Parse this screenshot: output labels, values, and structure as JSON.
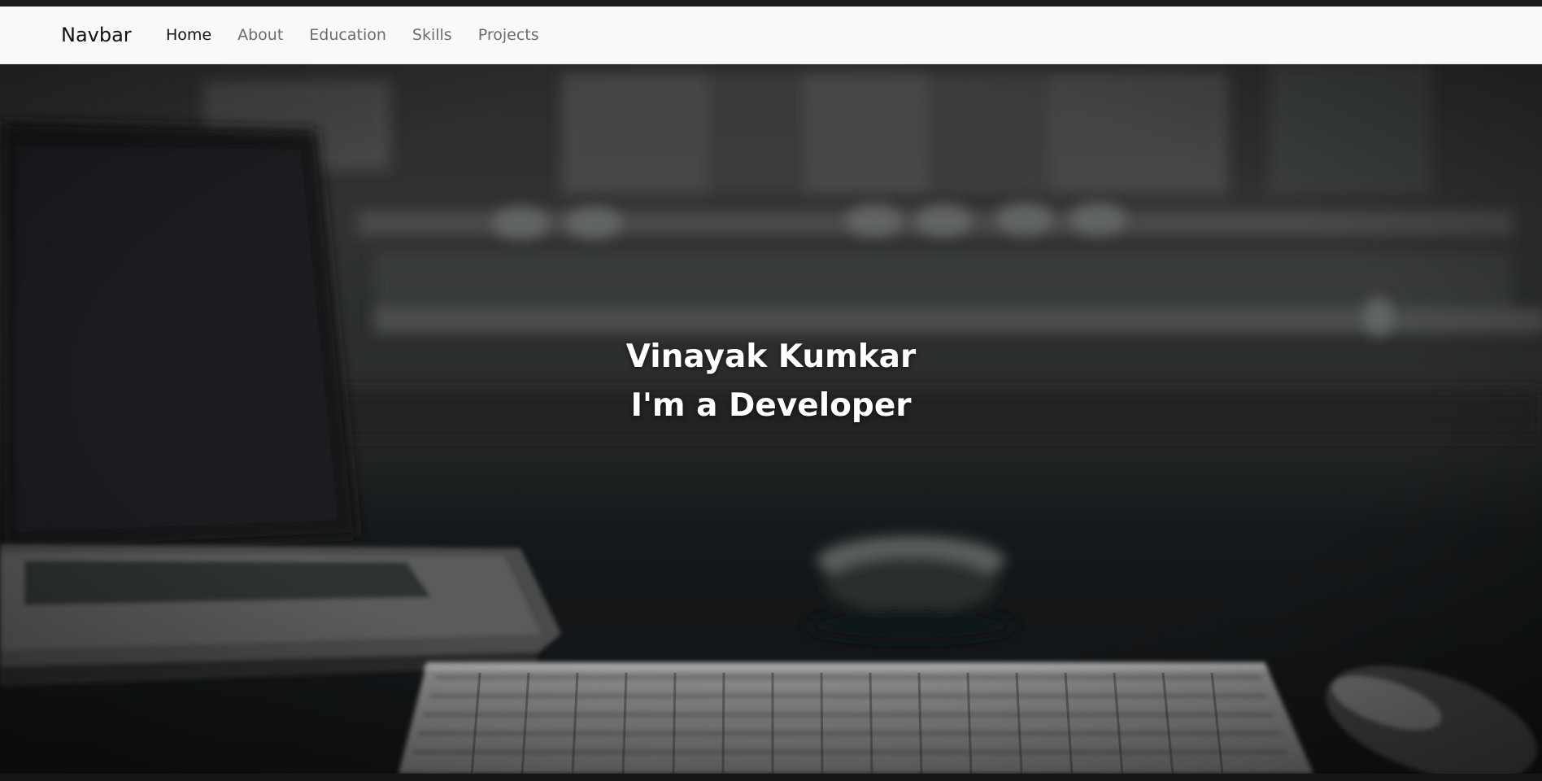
{
  "navbar": {
    "brand": "Navbar",
    "links": [
      {
        "label": "Home",
        "active": true
      },
      {
        "label": "About",
        "active": false
      },
      {
        "label": "Education",
        "active": false
      },
      {
        "label": "Skills",
        "active": false
      },
      {
        "label": "Projects",
        "active": false
      }
    ]
  },
  "hero": {
    "name": "Vinayak Kumkar",
    "tagline": "I'm a Developer"
  }
}
